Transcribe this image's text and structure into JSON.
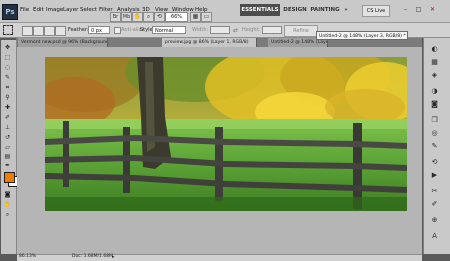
{
  "app": {
    "logo": "Ps"
  },
  "menu": [
    "File",
    "Edit",
    "Image",
    "Layer",
    "Select",
    "Filter",
    "Analysis",
    "3D",
    "View",
    "Window",
    "Help"
  ],
  "header": {
    "zoom": "66%",
    "workspaces": [
      "ESSENTIALS",
      "DESIGN",
      "PAINTING"
    ],
    "more_glyph": "»",
    "cs_live": "CS Live",
    "window_controls": [
      "–",
      "□",
      "✕"
    ]
  },
  "options": {
    "feather_label": "Feather:",
    "feather_value": "0 px",
    "antialias_label": "Anti-alias",
    "style_label": "Style:",
    "style_value": "Normal",
    "width_label": "Width:",
    "height_label": "Height:",
    "refine_edge": "Refine Edge..."
  },
  "tabs": [
    "Vermont new.psd @ 96% (Background copy, RGB/8) *",
    "preview.jpg @ 86% (Layer 1, RGB/8)",
    "Untitled-2 @ 148% (Layer 3, RGB/8)"
  ],
  "floating_tab": "Untitled-2 @ 148% (Layer 3, RGB/8) *",
  "tools": [
    "move-tool",
    "marquee-tool",
    "lasso-tool",
    "quick-select-tool",
    "crop-tool",
    "eyedropper-tool",
    "healing-tool",
    "brush-tool",
    "clone-stamp-tool",
    "history-brush-tool",
    "eraser-tool",
    "gradient-tool",
    "blur-tool",
    "dodge-tool",
    "pen-tool",
    "type-tool",
    "path-select-tool",
    "shape-tool",
    "3d-rotate-tool",
    "3d-orbit-tool",
    "hand-tool",
    "zoom-tool"
  ],
  "colors": {
    "foreground": "#ef7d00",
    "background": "#ffffff",
    "accent": "#4d4d4d"
  },
  "right_panel_icons": [
    "color-panel-icon",
    "swatches-icon",
    "styles-icon",
    "adjustments-icon",
    "masks-icon",
    "layers-icon",
    "channels-icon",
    "paths-icon",
    "history-icon",
    "actions-icon",
    "tool-presets-icon",
    "brushes-icon",
    "clone-source-icon",
    "character-icon"
  ],
  "status": {
    "zoom": "86.13%",
    "doc": "Doc: 1.68M/1.68M"
  }
}
